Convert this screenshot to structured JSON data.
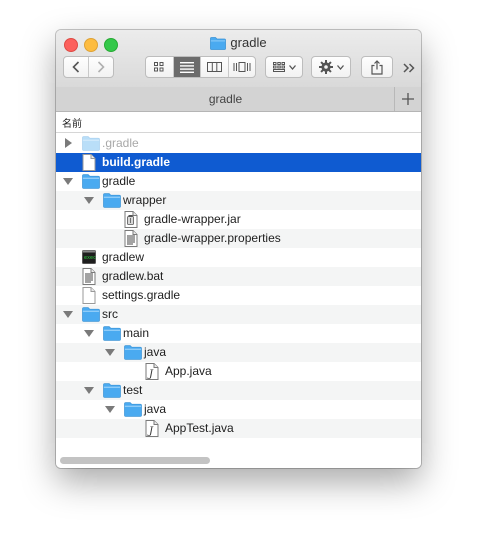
{
  "window": {
    "title": "gradle",
    "tab_label": "gradle",
    "column_header": "名前"
  },
  "toolbar": {
    "back_icon": "chevron-left-icon",
    "forward_icon": "chevron-right-icon",
    "view_modes": [
      "icon-view-icon",
      "list-view-icon",
      "column-view-icon",
      "cover-flow-icon"
    ],
    "active_view": "list-view-icon",
    "group_icon": "group-by-icon",
    "action_icon": "gear-icon",
    "share_icon": "share-icon",
    "overflow_icon": "overflow-chevrons-icon",
    "new_tab_icon": "plus-icon"
  },
  "colors": {
    "selection": "#0f5bd1",
    "folder": "#4aaaf0",
    "row_alt": "#f4f5f5"
  },
  "files": [
    {
      "name": ".gradle",
      "depth": 0,
      "type": "folder",
      "disclosure": "collapsed",
      "dimmed": true,
      "selected": false
    },
    {
      "name": "build.gradle",
      "depth": 0,
      "type": "file",
      "disclosure": "none",
      "dimmed": false,
      "selected": true
    },
    {
      "name": "gradle",
      "depth": 0,
      "type": "folder",
      "disclosure": "expanded",
      "dimmed": false,
      "selected": false
    },
    {
      "name": "wrapper",
      "depth": 1,
      "type": "folder",
      "disclosure": "expanded",
      "dimmed": false,
      "selected": false
    },
    {
      "name": "gradle-wrapper.jar",
      "depth": 2,
      "type": "jar",
      "disclosure": "none",
      "dimmed": false,
      "selected": false
    },
    {
      "name": "gradle-wrapper.properties",
      "depth": 2,
      "type": "document",
      "disclosure": "none",
      "dimmed": false,
      "selected": false
    },
    {
      "name": "gradlew",
      "depth": 0,
      "type": "executable",
      "disclosure": "none",
      "dimmed": false,
      "selected": false
    },
    {
      "name": "gradlew.bat",
      "depth": 0,
      "type": "document",
      "disclosure": "none",
      "dimmed": false,
      "selected": false
    },
    {
      "name": "settings.gradle",
      "depth": 0,
      "type": "file",
      "disclosure": "none",
      "dimmed": false,
      "selected": false
    },
    {
      "name": "src",
      "depth": 0,
      "type": "folder",
      "disclosure": "expanded",
      "dimmed": false,
      "selected": false
    },
    {
      "name": "main",
      "depth": 1,
      "type": "folder",
      "disclosure": "expanded",
      "dimmed": false,
      "selected": false
    },
    {
      "name": "java",
      "depth": 2,
      "type": "folder",
      "disclosure": "expanded",
      "dimmed": false,
      "selected": false
    },
    {
      "name": "App.java",
      "depth": 3,
      "type": "java",
      "disclosure": "none",
      "dimmed": false,
      "selected": false
    },
    {
      "name": "test",
      "depth": 1,
      "type": "folder",
      "disclosure": "expanded",
      "dimmed": false,
      "selected": false
    },
    {
      "name": "java",
      "depth": 2,
      "type": "folder",
      "disclosure": "expanded",
      "dimmed": false,
      "selected": false
    },
    {
      "name": "AppTest.java",
      "depth": 3,
      "type": "java",
      "disclosure": "none",
      "dimmed": false,
      "selected": false
    }
  ]
}
